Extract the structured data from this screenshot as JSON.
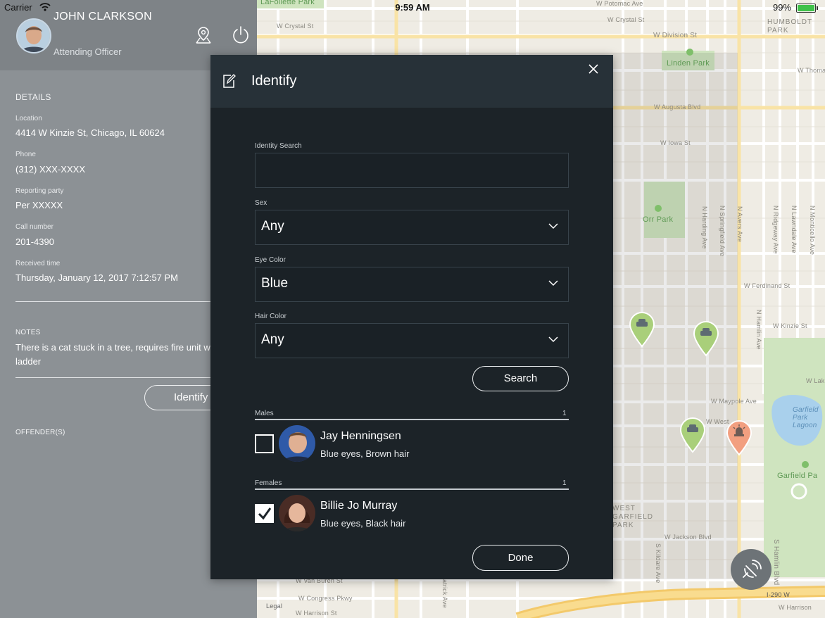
{
  "status_bar": {
    "carrier": "Carrier",
    "time": "9:59 AM",
    "battery": "99%"
  },
  "officer": {
    "name": "JOHN CLARKSON",
    "role": "Attending Officer"
  },
  "details": {
    "title": "DETAILS",
    "fields": [
      {
        "label": "Location",
        "value": "4414 W Kinzie St, Chicago, IL 60624"
      },
      {
        "label": "Phone",
        "value": "(312) XXX-XXXX"
      },
      {
        "label": "Reporting party",
        "value": "Per XXXXX"
      },
      {
        "label": "Call number",
        "value": "201-4390"
      },
      {
        "label": "Received time",
        "value": "Thursday, January 12, 2017 7:12:57 PM"
      }
    ]
  },
  "notes": {
    "title": "NOTES",
    "text": "There is a cat stuck in a tree, requires fire unit with ladder"
  },
  "identify_button_label": "Identify",
  "offenders_title": "OFFENDER(S)",
  "modal": {
    "title": "Identify",
    "identity_search": {
      "label": "Identity Search",
      "value": "",
      "placeholder": ""
    },
    "sex": {
      "label": "Sex",
      "value": "Any"
    },
    "eye_color": {
      "label": "Eye Color",
      "value": "Blue"
    },
    "hair_color": {
      "label": "Hair Color",
      "value": "Any"
    },
    "search_label": "Search",
    "groups": [
      {
        "label": "Males",
        "count": "1",
        "people": [
          {
            "name": "Jay Henningsen",
            "desc": "Blue eyes, Brown hair",
            "checked": false
          }
        ]
      },
      {
        "label": "Females",
        "count": "1",
        "people": [
          {
            "name": "Billie Jo Murray",
            "desc": "Blue eyes, Black hair",
            "checked": true
          }
        ]
      }
    ],
    "done_label": "Done"
  },
  "map": {
    "labels": {
      "lafollette": "LaFollette Park",
      "potomac": "W Potomac Ave",
      "crystal1": "W Crystal St",
      "crystal2": "W Crystal St",
      "humboldt": "HUMBOLDT PARK",
      "division": "W Division St",
      "thomas": "W Thoma",
      "linden": "Linden Park",
      "augusta": "W Augusta Blvd",
      "iowa": "W Iowa St",
      "orr": "Orr Park",
      "harding": "N Harding Ave",
      "springfield": "N Springfield Ave",
      "avers": "N Avers Ave",
      "ridgeway": "N Ridgeway Ave",
      "lawndale": "N Lawndale Ave",
      "monticello": "N Monticello Ave",
      "ferdinand": "W Ferdinand St",
      "kinzie": "W Kinzie St",
      "hamlin_n": "N Hamlin Ave",
      "lake": "W Lak",
      "maypole": "W Maypole Ave",
      "west_fr": "W West",
      "garfield_lagoon": "Garfield Park Lagoon",
      "garfield_pa": "Garfield Pa",
      "west_garfield": "WEST GARFIELD PARK",
      "jackson": "W Jackson Blvd",
      "hamlin_s": "S Hamlin Blvd",
      "kildare": "S Kildare Ave",
      "vanburen": "W Van Buren St",
      "congress": "W Congress Pkwy",
      "harrison1": "W Harrison St",
      "harrison2": "W Harrison",
      "i290": "I-290 W",
      "legal": "Legal",
      "patrick": "atrick Ave"
    },
    "colors": {
      "land": "#efece4",
      "park": "#cfe4bf",
      "water": "#a9d0ec",
      "road": "#ffffff",
      "highway": "#f7d67c",
      "unit_pin": "#a9cf7a",
      "incident_pin": "#f29f80"
    }
  }
}
